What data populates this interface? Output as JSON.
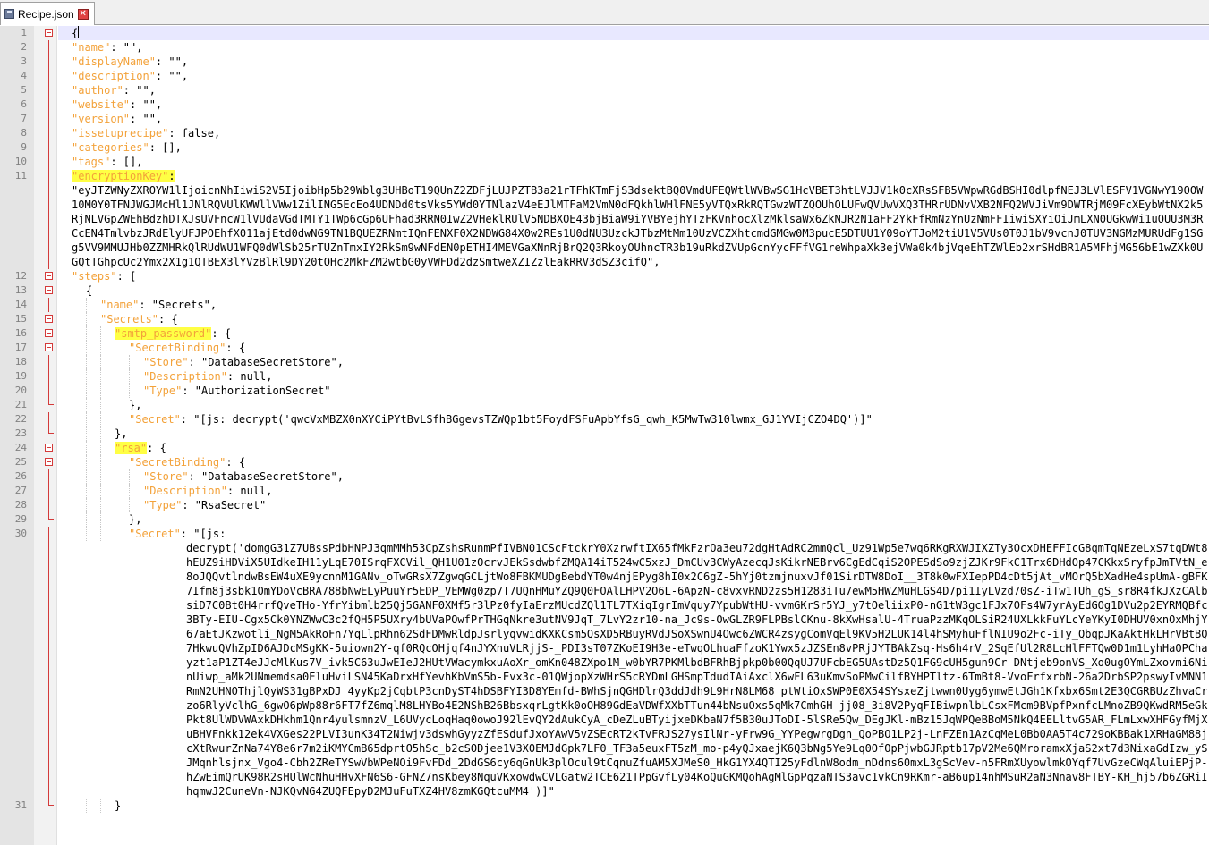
{
  "tab": {
    "title": "Recipe.json"
  },
  "lines": {
    "l1": {
      "n": "1",
      "t": "{"
    },
    "l2": {
      "n": "2",
      "k": "\"name\"",
      "v": ": \"\","
    },
    "l3": {
      "n": "3",
      "k": "\"displayName\"",
      "v": ": \"\","
    },
    "l4": {
      "n": "4",
      "k": "\"description\"",
      "v": ": \"\","
    },
    "l5": {
      "n": "5",
      "k": "\"author\"",
      "v": ": \"\","
    },
    "l6": {
      "n": "6",
      "k": "\"website\"",
      "v": ": \"\","
    },
    "l7": {
      "n": "7",
      "k": "\"version\"",
      "v": ": \"\","
    },
    "l8": {
      "n": "8",
      "k": "\"issetuprecipe\"",
      "v": ": false,"
    },
    "l9": {
      "n": "9",
      "k": "\"categories\"",
      "v": ": [],"
    },
    "l10": {
      "n": "10",
      "k": "\"tags\"",
      "v": ": [],"
    },
    "l11": {
      "n": "11",
      "k": "\"encryptionKey\"",
      "v": ":",
      "wrap": "\"eyJTZWNyZXROYW1lIjoicnNhIiwiS2V5IjoibHp5b29Wblg3UHBoT19QUnZ2ZDFjLUJPZTB3a21rTFhKTmFjS3dsektBQ0VmdUFEQWtlWVBwSG1HcVBET3htLVJJV1k0cXRsSFB5VWpwRGdBSHI0dlpfNEJ3LVlESFV1VGNwY19OOW10M0Y0TFNJWGJMcHl1JNlRQVUlKWWllVWw1ZilING5EcEo4UDNDd0tsVks5YWd0YTNlazV4eEJlMTFaM2VmN0dFQkhlWHlFNE5yVTQxRkRQTGwzWTZQOUhOLUFwQVUwVXQ3THRrUDNvVXB2NFQ2WVJiVm9DWTRjM09FcXEybWtNX2k5RjNLVGpZWEhBdzhDTXJsUVFncW1lVUdaVGdTMTY1TWp6cGp6UFhad3RRN0IwZ2VHeklRUlV5NDBXOE43bjBiaW9iYVBYejhYTzFKVnhocXlzMklsaWx6ZkNJR2N1aFF2YkFfRmNzYnUzNmFFIiwiSXYiOiJmLXN0UGkwWi1uOUU3M3RCcEN4TmlvbzJRdElyUFJPOEhfX011ajEtd0dwNG9TN1BQUEZRNmtIQnFENXF0X2NDWG84X0w2REs1U0dNU3UzckJTbzMtMm10UzVCZXhtcmdGMGw0M3pucE5DTUU1Y09oYTJoM2tiU1V5VUs0T0J1bV9vcnJ0TUV3NGMzMURUdFg1SGg5VV9MMUJHb0ZZMHRkQlRUdWU1WFQ0dWlSb25rTUZnTmxIY2RkSm9wNFdEN0pETHI4MEVGaXNnRjBrQ2Q3RkoyOUhncTR3b19uRkdZVUpGcnYycFFfVG1reWhpaXk3ejVWa0k4bjVqeEhTZWlEb2xrSHdBR1A5MFhjMG56bE1wZXk0UGQtTGhpcUc2Ymx2X1g1QTBEX3lYVzBlRl9DY20tOHc2MkFZM2wtbG0yVWFDd2dzSmtweXZIZzlEakRRV3dSZ3cifQ\","
    },
    "l12": {
      "n": "12",
      "k": "\"steps\"",
      "v": ": ["
    },
    "l13": {
      "n": "13",
      "t": "{"
    },
    "l14": {
      "n": "14",
      "k": "\"name\"",
      "v": ": \"Secrets\","
    },
    "l15": {
      "n": "15",
      "k": "\"Secrets\"",
      "v": ": {"
    },
    "l16": {
      "n": "16",
      "k": "\"smtp_password\"",
      "v": ": {"
    },
    "l17": {
      "n": "17",
      "k": "\"SecretBinding\"",
      "v": ": {"
    },
    "l18": {
      "n": "18",
      "k": "\"Store\"",
      "v": ": \"DatabaseSecretStore\","
    },
    "l19": {
      "n": "19",
      "k": "\"Description\"",
      "v": ": null,"
    },
    "l20": {
      "n": "20",
      "k": "\"Type\"",
      "v": ": \"AuthorizationSecret\""
    },
    "l21": {
      "n": "21",
      "t": "},"
    },
    "l22": {
      "n": "22",
      "k": "\"Secret\"",
      "v": ": \"[js: decrypt('qwcVxMBZX0nXYCiPYtBvLSfhBGgevsTZWQp1bt5FoydFSFuApbYfsG_qwh_K5MwTw310lwmx_GJ1YVIjCZO4DQ')]\""
    },
    "l23": {
      "n": "23",
      "t": "},"
    },
    "l24": {
      "n": "24",
      "k": "\"rsa\"",
      "v": ": {"
    },
    "l25": {
      "n": "25",
      "k": "\"SecretBinding\"",
      "v": ": {"
    },
    "l26": {
      "n": "26",
      "k": "\"Store\"",
      "v": ": \"DatabaseSecretStore\","
    },
    "l27": {
      "n": "27",
      "k": "\"Description\"",
      "v": ": null,"
    },
    "l28": {
      "n": "28",
      "k": "\"Type\"",
      "v": ": \"RsaSecret\""
    },
    "l29": {
      "n": "29",
      "t": "},"
    },
    "l30": {
      "n": "30",
      "k": "\"Secret\"",
      "v": ": \"[js:",
      "wrap": "decrypt('domgG31Z7UBssPdbHNPJ3qmMMh53CpZshsRunmPfIVBN01CScFtckrY0XzrwftIX65fMkFzrOa3eu72dgHtAdRC2mmQcl_Uz91Wp5e7wq6RKgRXWJIXZTy3OcxDHEFFIcG8qmTqNEzeLxS7tqDWt8hEUZ9iHDViX5UIdkeIH11yLqE70ISrqFXCVil_QH1U01zOcrvJEkSsdwbfZMQA14iT524wC5xzJ_DmCUv3CWyAzecqJsKikrNEBrv6CgEdCqiS2OPESdSo9zjZJKr9FkC1Trx6DHdOp47CKkxSryfpJmTVtN_e8oJQQvtlndwBsEW4uXE9ycnnM1GANv_oTwGRsX7ZgwqGCLjtWo8FBKMUDgBebdYT0w4njEPyg8hI0x2C6gZ-5hYj0tzmjnuxvJf01SirDTW8DoI__3T8k0wFXIepPD4cDt5jAt_vMOrQ5bXadHe4spUmA-gBFK7Ifm8j3sbk1OmYDoVcBRA788bNwELyPuuYr5EDP_VEMWg0zp7T7UQnHMuYZQ9Q0FOAlLHPV2O6L-6ApzN-c8vxvRND2zs5H1283iTu7ewM5HWZMuHLGS4D7pi1IyLVzd70sZ-iTw1TUh_gS_sr8R4fkJXzCAlbsiD7C0Bt0H4rrfQveTHo-YfrYibmlb25Qj5GANF0XMf5r3lPz0fyIaErzMUcdZQl1TL7TXiqIgrImVquy7YpubWtHU-vvmGKrSr5YJ_y7tOeliixP0-nG1tW3gc1FJx7OFs4W7yrAyEdGOg1DVu2p2EYRMQBfc3BTy-EIU-Cgx5Ck0YNZWwC3c2fQH5P5UXry4bUVaPOwfPrTHGqNkre3utNV9JqT_7LvY2zr10-na_Jc9s-OwGLZR9FLPBslCKnu-8kXwHsalU-4TruaPzzMKqOLSiR24UXLkkFuYLcYeYKyI0DHUV0xnOxMhjY67aEtJKzwotli_NgM5AkRoFn7YqLlpRhn62SdFDMwRldpJsrlyqvwidKXKCsm5QsXD5RBuyRVdJSoXSwnU4Owc6ZWCR4zsygComVqEl9KV5H2LUK14l4hSMyhuFflNIU9o2Fc-iTy_QbqpJKaAktHkLHrVBtBQ7HkwuQVhZpID6AJDcMSgKK-5uiown2Y-qf0RQcOHjqf4nJYXnuVLRjjS-_PDI3sT07ZKoEI9H3e-eTwqOLhuaFfzoK1Ywx5zJZSEn8vPRjJYTBAkZsq-Hs6h4rV_2SqEfUl2R8LcHlFFTQw0D1m1LyhHaOPChayzt1aP1ZT4eJJcMlKus7V_ivk5C63uJwEIeJ2HUtVWacymkxuAoXr_omKn048ZXpo1M_w0bYR7PKMlbdBFRhBjpkp0b00QqUJ7UFcbEG5UAstDz5Q1FG9cUH5gun9Cr-DNtjeb9onVS_Xo0ugOYmLZxovmi6NinUiwp_aMk2UNmemdsa0EluHviLSN45KaDrxHfYevhKbVmS5b-Evx3c-01QWjopXzWHrS5cRYDmLGHSmpTdudIAiAxclX6wFL63uKmvSoPMwCilfBYHPTltz-6TmBt8-VvoFrfxrbN-26a2DrbSP2pswyIvMNN1RmN2UHNOThjlQyWS31gBPxDJ_4yyKp2jCqbtP3cnDyST4hDSBFYI3D8YEmfd-BWhSjnQGHDlrQ3ddJdh9L9HrN8LM68_ptWtiOxSWP0E0X54SYsxeZjtwwn0Uyg6ymwEtJGh1Kfxbx6Smt2E3QCGRBUzZhvaCrzo6RlyVclhG_6gwO6pWp88r6FT7fZ6mqlM8LHYBo4E2NShB26BbsxqrLgtKk0oOH89GdEaVDWfXXbTTun44bNsuOxs5qMk7CmhGH-jj08_3i8V2PyqFIBiwpnlbLCsxFMcm9BVpfPxnfcLMnoZB9QKwdRM5eGkPkt8UlWDVWAxkDHkhm1Qnr4yulsmnzV_L6UVycLoqHaq0owoJ92lEvQY2dAukCyA_cDeZLuBTyijxeDKbaN7f5B30uJToDI-5lSRe5Qw_DEgJKl-mBz15JqWPQeBBoM5NkQ4EELltvG5AR_FLmLxwXHFGyfMjXuBHVFnkk12ek4VXGes22PLVI3unK34T2Niwjv3dswhGyyzZfESdufJxoYAwV5vZSEcRT2kTvFRJS27ysIlNr-yFrw9G_YYPegwrgDgn_QoPBO1LP2j-LnFZEn1AzCqMeL0Bb0AA5T4c729oKBBak1XRHaGM88jcXtRwurZnNa74Y8e6r7m2iKMYCmB65dprtO5hSc_b2cSODjee1V3X0EMJdGpk7LF0_TF3a5euxFT5zM_mo-p4yQJxaejK6Q3bNg5Ye9Lq0OfOpPjwbGJRptb17pV2Me6QMroramxXjaS2xt7d3NixaGdIzw_ySJMqnhlsjnx_Vgo4-Cbh2ZReTYSwVbWPeNOi9FvFDd_2DdGS6cy6qGnUk3plOcul9tCqnuZfuAM5XJMeS0_HkG1YX4QTI25yFdlnW8odm_nDdns60mxL3gScVev-n5FRmXUyowlmkOYqf7UvGzeCWqAluiEPjP-hZwEimQrUK98R2sHUlWcNhuHHvXFN6S6-GFNZ7nsKbey8NquVKxowdwCVLGatw2TCE621TPpGvfLy04KoQuGKMQohAgMlGpPqzaNTS3avc1vkCn9RKmr-aB6up14nhMSuR2aN3Nnav8FTBY-KH_hj57b6ZGRiIhqmwJ2CuneVn-NJKQvNG4ZUQFEpyD2MJuFuTXZ4HV8zmKGQtcuMM4')]\""
    },
    "l31": {
      "n": "31",
      "t": "}"
    }
  }
}
